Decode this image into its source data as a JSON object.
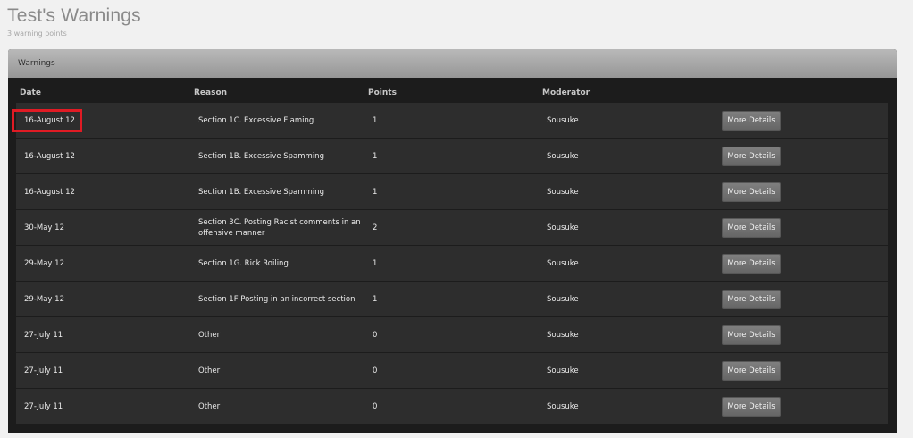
{
  "page": {
    "title": "Test's Warnings",
    "subtitle": "3 warning points"
  },
  "panel": {
    "title": "Warnings"
  },
  "table": {
    "columns": [
      "Date",
      "Reason",
      "Points",
      "Moderator"
    ],
    "button_label": "More Details",
    "rows": [
      {
        "date": "16-August 12",
        "reason": "Section 1C. Excessive Flaming",
        "points": "1",
        "moderator": "Sousuke",
        "highlighted": true
      },
      {
        "date": "16-August 12",
        "reason": "Section 1B. Excessive Spamming",
        "points": "1",
        "moderator": "Sousuke"
      },
      {
        "date": "16-August 12",
        "reason": "Section 1B. Excessive Spamming",
        "points": "1",
        "moderator": "Sousuke"
      },
      {
        "date": "30-May 12",
        "reason": "Section 3C. Posting Racist comments in an offensive manner",
        "points": "2",
        "moderator": "Sousuke"
      },
      {
        "date": "29-May 12",
        "reason": "Section 1G. Rick Roiling",
        "points": "1",
        "moderator": "Sousuke"
      },
      {
        "date": "29-May 12",
        "reason": "Section 1F Posting in an incorrect section",
        "points": "1",
        "moderator": "Sousuke"
      },
      {
        "date": "27-July 11",
        "reason": "Other",
        "points": "0",
        "moderator": "Sousuke"
      },
      {
        "date": "27-July 11",
        "reason": "Other",
        "points": "0",
        "moderator": "Sousuke"
      },
      {
        "date": "27-July 11",
        "reason": "Other",
        "points": "0",
        "moderator": "Sousuke"
      }
    ]
  },
  "colors": {
    "highlight": "#e01b24",
    "row_background": "#2d2d2d",
    "panel_background": "#1c1c1c"
  }
}
